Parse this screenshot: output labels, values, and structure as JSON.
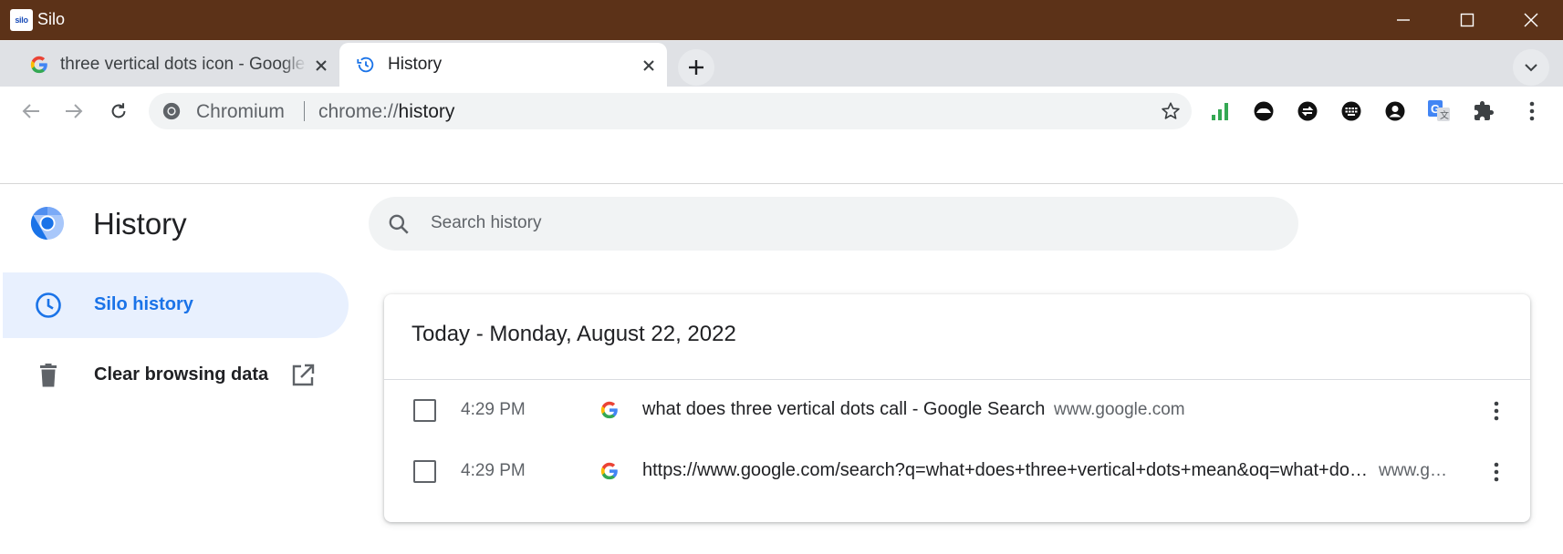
{
  "window": {
    "app_name": "Silo",
    "logo_text": "silo",
    "colors": {
      "titlebar": "#5c3218",
      "accent": "#1a73e8"
    }
  },
  "tabs": [
    {
      "label": "three vertical dots icon - Google Search",
      "icon": "google-g-icon",
      "active": false
    },
    {
      "label": "History",
      "icon": "history-clock-icon",
      "active": true
    }
  ],
  "omnibox": {
    "site_label": "Chromium",
    "url_scheme": "chrome://",
    "url_host": "history"
  },
  "extensions": [
    "signal-bars-icon",
    "cloud-circle-icon",
    "sync-icon",
    "keyboard-icon",
    "account-circle-icon",
    "translate-icon",
    "puzzle-icon",
    "more-vert-icon"
  ],
  "page": {
    "title": "History",
    "search_placeholder": "Search history",
    "sidebar": {
      "items": [
        {
          "label": "Silo history",
          "icon": "clock-icon",
          "selected": true
        },
        {
          "label": "Clear browsing data",
          "icon": "trash-icon",
          "selected": false
        }
      ]
    },
    "card": {
      "date_heading": "Today - Monday, August 22, 2022",
      "entries": [
        {
          "time": "4:29 PM",
          "title": "what does three vertical dots call - Google Search",
          "domain": "www.google.com"
        },
        {
          "time": "4:29 PM",
          "title": "https://www.google.com/search?q=what+does+three+vertical+dots+mean&oq=what+do…",
          "domain": "www.g…"
        }
      ]
    }
  }
}
